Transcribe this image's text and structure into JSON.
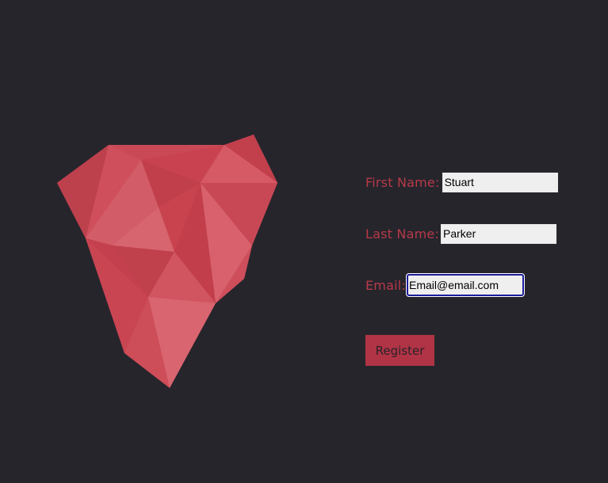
{
  "form": {
    "first_name": {
      "label": "First Name:",
      "value": "Stuart"
    },
    "last_name": {
      "label": "Last Name:",
      "value": "Parker"
    },
    "email": {
      "label": "Email:",
      "value": "Email@email.com"
    },
    "register_label": "Register"
  },
  "colors": {
    "background": "#27252c",
    "accent": "#b63a4a",
    "button": "#b03446"
  },
  "icons": {
    "logo": "low-poly-heart-logo"
  }
}
